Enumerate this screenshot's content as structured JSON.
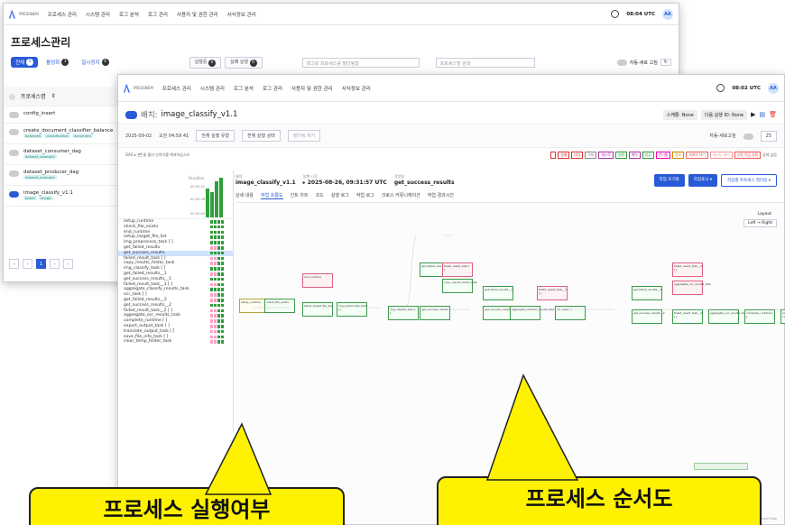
{
  "nav": {
    "logo_text": "PRESSNEM",
    "items": [
      "프로세스 관리",
      "시스템 관리",
      "로그 분석",
      "로그 관리",
      "사용자 및 권한 관리",
      "서식정보 관리"
    ],
    "time_back": "08:04 UTC",
    "time_front": "08:02 UTC",
    "avatar": "AA"
  },
  "back": {
    "page_title": "프로세스관리",
    "tabs": [
      {
        "label": "전체",
        "count": "5"
      },
      {
        "label": "활성화",
        "count": "1"
      },
      {
        "label": "일시정지",
        "count": "4"
      }
    ],
    "pills": [
      {
        "label": "실행중",
        "count": "0"
      },
      {
        "label": "실패 실행",
        "count": "0"
      }
    ],
    "tag_search_placeholder": "태그로 프로세스를 필터링합",
    "search_placeholder": "프로세스명 검색",
    "auto_refresh": "자동-새로 고침",
    "sidebar_header": "프로세스명",
    "processes": [
      {
        "name": "config_insert",
        "tags": [],
        "on": false
      },
      {
        "name": "create_document_classifier_balance",
        "tags": [
          "balanced",
          "classification",
          "document"
        ],
        "on": false
      },
      {
        "name": "dataset_consumer_dag",
        "tags": [
          "dataset_example"
        ],
        "on": false
      },
      {
        "name": "dataset_producer_dag",
        "tags": [
          "dataset_example"
        ],
        "on": false
      },
      {
        "name": "image_classify_v1.1",
        "tags": [
          "batch",
          "image"
        ],
        "on": true
      }
    ],
    "pager": [
      "‹",
      "‹",
      "1",
      "›",
      "›"
    ]
  },
  "front": {
    "dag_prefix": "배치:",
    "dag_name": "image_classify_v1.1",
    "schedule": "스케줄: None",
    "next_run": "다음 실행 ID: None",
    "date": "2025-09-02",
    "time_field": "오전 04:59 41",
    "run_type": "전체 실행 유형",
    "run_state": "전체 실행 상태",
    "filter_clear": "필터링 제거",
    "auto_refresh": "자동-새로고침",
    "page_size": "25",
    "legend_prefix": "DAG ▸ 🗂 몰 블리 안하기를 해쳐하십시오",
    "legend": [
      {
        "t": "",
        "c": "#d33"
      },
      {
        "t": "실패",
        "c": "#d33"
      },
      {
        "t": "대기",
        "c": "#d33"
      },
      {
        "t": "삭제",
        "c": "#888"
      },
      {
        "t": "재시작",
        "c": "#a3a"
      },
      {
        "t": "실행",
        "c": "#2e9e3a"
      },
      {
        "t": "예약",
        "c": "#a3a"
      },
      {
        "t": "성공",
        "c": "#2e9e3a"
      },
      {
        "t": "건너뜀",
        "c": "#e0a"
      },
      {
        "t": "종료",
        "c": "#c80"
      },
      {
        "t": "재예약 대기",
        "c": "#d66"
      },
      {
        "t": "재시도 대기",
        "c": "#e99"
      },
      {
        "t": "상위 작업 실패",
        "c": "#e55"
      }
    ],
    "legend_tail": "상태 없음",
    "duration_label": "Duration",
    "duration_ticks": [
      "00:00:52",
      "00:00:26",
      "00:00:00"
    ],
    "tasks": [
      "setup_runtime",
      "check_file_exists",
      "end_runtime",
      "setup_target_file_list",
      "img_preprocess_task [ ]",
      "get_failed_results",
      "get_success_results",
      "failed_result_task [ ]",
      "copy_results_folder_task",
      "img_classify_task [ ]",
      "get_failed_results__1",
      "get_success_results__1",
      "failed_result_task__1 [ ]",
      "aggregate_classify_results_task",
      "ocr_task [ ]",
      "get_failed_results__2",
      "get_success_results__2",
      "failed_result_task__2 [ ]",
      "aggregate_ocr_results_task",
      "complete_runtime [ ]",
      "export_output_task [ ]",
      "translate_output_task [ ]",
      "save_file_info_task [ ]",
      "clear_temp_folder_task"
    ],
    "highlight_index": 6,
    "crumbs": [
      {
        "k": "배치",
        "v": "image_classify_v1.1"
      },
      {
        "k": "실행 시각",
        "v": "▸ 2025-08-26, 09:31:57 UTC"
      },
      {
        "k": "작업명",
        "v": "get_success_results"
      }
    ],
    "buttons": {
      "clear": "작업 초기화",
      "mark": "작업표시 ▾",
      "filter": "작업별 프로세스 필터링 ▾"
    },
    "subtabs": [
      "상세 내용",
      "작업 흐름도",
      "간트 차트",
      "코드",
      "실행 로그",
      "작업 로그",
      "크로스 커뮤니케이션",
      "작업 경과시간"
    ],
    "layout_label": "Layout",
    "layout_value": "Left → Right",
    "react_flow": "React Flow",
    "plus": "+"
  },
  "callouts": {
    "left": "프로세스 실행여부",
    "right": "프로세스 순서도"
  },
  "colors": {
    "accent": "#2a5bd7",
    "success": "#2e9e3a",
    "callout": "#fff200"
  }
}
